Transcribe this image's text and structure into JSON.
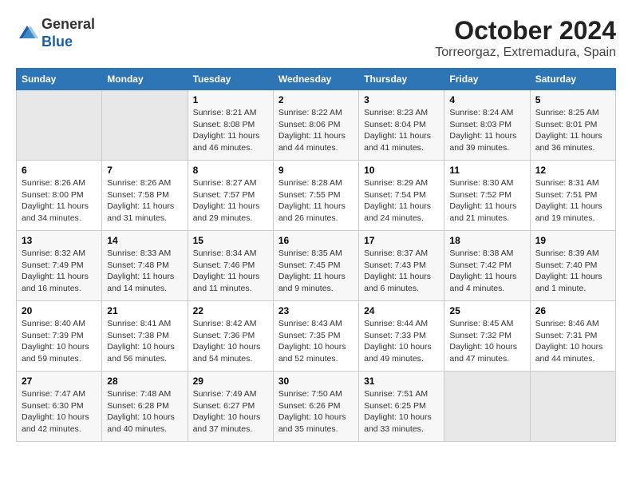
{
  "header": {
    "logo_line1": "General",
    "logo_line2": "Blue",
    "month_year": "October 2024",
    "location": "Torreorgaz, Extremadura, Spain"
  },
  "calendar": {
    "weekdays": [
      "Sunday",
      "Monday",
      "Tuesday",
      "Wednesday",
      "Thursday",
      "Friday",
      "Saturday"
    ],
    "weeks": [
      [
        {
          "day": "",
          "content": ""
        },
        {
          "day": "",
          "content": ""
        },
        {
          "day": "1",
          "content": "Sunrise: 8:21 AM\nSunset: 8:08 PM\nDaylight: 11 hours and 46 minutes."
        },
        {
          "day": "2",
          "content": "Sunrise: 8:22 AM\nSunset: 8:06 PM\nDaylight: 11 hours and 44 minutes."
        },
        {
          "day": "3",
          "content": "Sunrise: 8:23 AM\nSunset: 8:04 PM\nDaylight: 11 hours and 41 minutes."
        },
        {
          "day": "4",
          "content": "Sunrise: 8:24 AM\nSunset: 8:03 PM\nDaylight: 11 hours and 39 minutes."
        },
        {
          "day": "5",
          "content": "Sunrise: 8:25 AM\nSunset: 8:01 PM\nDaylight: 11 hours and 36 minutes."
        }
      ],
      [
        {
          "day": "6",
          "content": "Sunrise: 8:26 AM\nSunset: 8:00 PM\nDaylight: 11 hours and 34 minutes."
        },
        {
          "day": "7",
          "content": "Sunrise: 8:26 AM\nSunset: 7:58 PM\nDaylight: 11 hours and 31 minutes."
        },
        {
          "day": "8",
          "content": "Sunrise: 8:27 AM\nSunset: 7:57 PM\nDaylight: 11 hours and 29 minutes."
        },
        {
          "day": "9",
          "content": "Sunrise: 8:28 AM\nSunset: 7:55 PM\nDaylight: 11 hours and 26 minutes."
        },
        {
          "day": "10",
          "content": "Sunrise: 8:29 AM\nSunset: 7:54 PM\nDaylight: 11 hours and 24 minutes."
        },
        {
          "day": "11",
          "content": "Sunrise: 8:30 AM\nSunset: 7:52 PM\nDaylight: 11 hours and 21 minutes."
        },
        {
          "day": "12",
          "content": "Sunrise: 8:31 AM\nSunset: 7:51 PM\nDaylight: 11 hours and 19 minutes."
        }
      ],
      [
        {
          "day": "13",
          "content": "Sunrise: 8:32 AM\nSunset: 7:49 PM\nDaylight: 11 hours and 16 minutes."
        },
        {
          "day": "14",
          "content": "Sunrise: 8:33 AM\nSunset: 7:48 PM\nDaylight: 11 hours and 14 minutes."
        },
        {
          "day": "15",
          "content": "Sunrise: 8:34 AM\nSunset: 7:46 PM\nDaylight: 11 hours and 11 minutes."
        },
        {
          "day": "16",
          "content": "Sunrise: 8:35 AM\nSunset: 7:45 PM\nDaylight: 11 hours and 9 minutes."
        },
        {
          "day": "17",
          "content": "Sunrise: 8:37 AM\nSunset: 7:43 PM\nDaylight: 11 hours and 6 minutes."
        },
        {
          "day": "18",
          "content": "Sunrise: 8:38 AM\nSunset: 7:42 PM\nDaylight: 11 hours and 4 minutes."
        },
        {
          "day": "19",
          "content": "Sunrise: 8:39 AM\nSunset: 7:40 PM\nDaylight: 11 hours and 1 minute."
        }
      ],
      [
        {
          "day": "20",
          "content": "Sunrise: 8:40 AM\nSunset: 7:39 PM\nDaylight: 10 hours and 59 minutes."
        },
        {
          "day": "21",
          "content": "Sunrise: 8:41 AM\nSunset: 7:38 PM\nDaylight: 10 hours and 56 minutes."
        },
        {
          "day": "22",
          "content": "Sunrise: 8:42 AM\nSunset: 7:36 PM\nDaylight: 10 hours and 54 minutes."
        },
        {
          "day": "23",
          "content": "Sunrise: 8:43 AM\nSunset: 7:35 PM\nDaylight: 10 hours and 52 minutes."
        },
        {
          "day": "24",
          "content": "Sunrise: 8:44 AM\nSunset: 7:33 PM\nDaylight: 10 hours and 49 minutes."
        },
        {
          "day": "25",
          "content": "Sunrise: 8:45 AM\nSunset: 7:32 PM\nDaylight: 10 hours and 47 minutes."
        },
        {
          "day": "26",
          "content": "Sunrise: 8:46 AM\nSunset: 7:31 PM\nDaylight: 10 hours and 44 minutes."
        }
      ],
      [
        {
          "day": "27",
          "content": "Sunrise: 7:47 AM\nSunset: 6:30 PM\nDaylight: 10 hours and 42 minutes."
        },
        {
          "day": "28",
          "content": "Sunrise: 7:48 AM\nSunset: 6:28 PM\nDaylight: 10 hours and 40 minutes."
        },
        {
          "day": "29",
          "content": "Sunrise: 7:49 AM\nSunset: 6:27 PM\nDaylight: 10 hours and 37 minutes."
        },
        {
          "day": "30",
          "content": "Sunrise: 7:50 AM\nSunset: 6:26 PM\nDaylight: 10 hours and 35 minutes."
        },
        {
          "day": "31",
          "content": "Sunrise: 7:51 AM\nSunset: 6:25 PM\nDaylight: 10 hours and 33 minutes."
        },
        {
          "day": "",
          "content": ""
        },
        {
          "day": "",
          "content": ""
        }
      ]
    ]
  }
}
